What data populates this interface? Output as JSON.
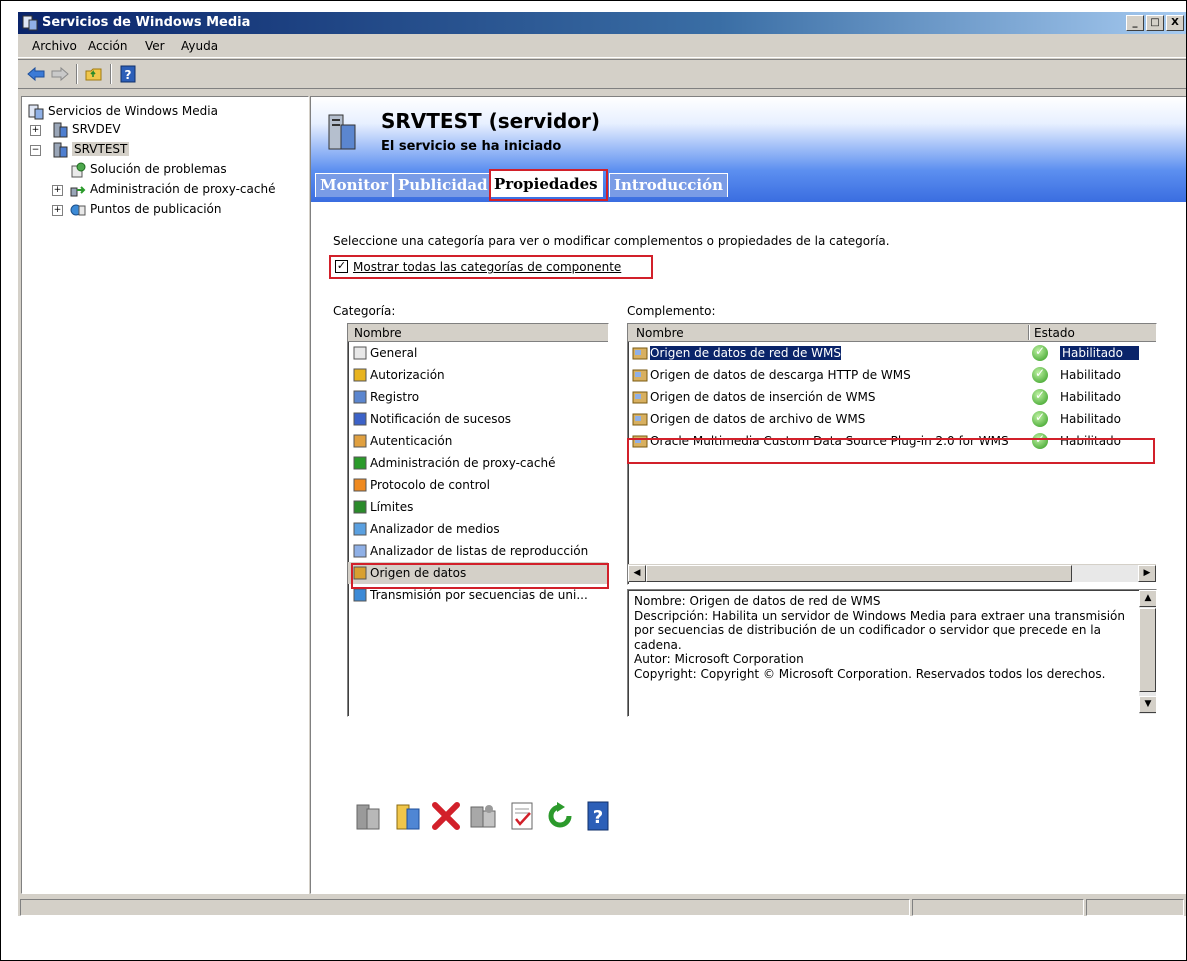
{
  "window": {
    "title": "Servicios de Windows Media",
    "buttons": [
      "_",
      "□",
      "X"
    ]
  },
  "menu": [
    "Archivo",
    "Acción",
    "Ver",
    "Ayuda"
  ],
  "toolbar": {
    "buttons": [
      {
        "name": "back-arrow-icon"
      },
      {
        "name": "forward-arrow-icon"
      },
      {
        "name": "up-folder-icon"
      },
      {
        "name": "help-icon"
      }
    ]
  },
  "tree": {
    "root": "Servicios de Windows Media",
    "items": [
      {
        "label": "SRVDEV",
        "toggle": "+",
        "level": 1
      },
      {
        "label": "SRVTEST",
        "toggle": "−",
        "level": 1
      },
      {
        "label": "Solución de problemas",
        "toggle": "",
        "level": 2
      },
      {
        "label": "Administración de proxy-caché",
        "toggle": "+",
        "level": 2
      },
      {
        "label": "Puntos de publicación",
        "toggle": "+",
        "level": 2
      }
    ]
  },
  "header": {
    "server_title": "SRVTEST (servidor)",
    "server_status": "El servicio se ha iniciado"
  },
  "tabs": [
    {
      "label": "Monitor",
      "active": false
    },
    {
      "label": "Publicidad",
      "active": false
    },
    {
      "label": "Propiedades",
      "active": true
    },
    {
      "label": "Introducción",
      "active": false
    }
  ],
  "properties": {
    "instruction": "Seleccione una categoría para ver o modificar complementos o propiedades de la categoría.",
    "show_all_checkbox": {
      "label": "Mostrar todas las categorías de componente",
      "checked": true,
      "mark": "✓"
    },
    "category_label": "Categoría:",
    "plugin_label": "Complemento:",
    "category_list": {
      "header": "Nombre",
      "items": [
        "General",
        "Autorización",
        "Registro",
        "Notificación de sucesos",
        "Autenticación",
        "Administración de proxy-caché",
        "Protocolo de control",
        "Límites",
        "Analizador de medios",
        "Analizador de listas de reproducción",
        "Origen de datos",
        "Transmisión por secuencias de uni..."
      ],
      "selected": "Origen de datos"
    },
    "plugin_list": {
      "headers": [
        "Nombre",
        "Estado"
      ],
      "rows": [
        {
          "name": "Origen de datos de red de WMS",
          "status": "Habilitado"
        },
        {
          "name": "Origen de datos de descarga HTTP de WMS",
          "status": "Habilitado"
        },
        {
          "name": "Origen de datos de inserción de WMS",
          "status": "Habilitado"
        },
        {
          "name": "Origen de datos de archivo de WMS",
          "status": "Habilitado"
        },
        {
          "name": "Oracle Multimedia Custom Data Source Plug-in 2.0 for WMS",
          "status": "Habilitado"
        }
      ],
      "selected": "Origen de datos de red de WMS"
    },
    "description": [
      "Nombre: Origen de datos de red de WMS",
      "Descripción: Habilita un servidor de Windows Media para extraer una transmisión por secuencias de distribución de un codificador o servidor que precede en la cadena.",
      "Autor: Microsoft Corporation",
      "Copyright: Copyright © Microsoft Corporation.  Reservados todos los derechos."
    ],
    "action_icons": [
      "disable-icon",
      "copy-icon",
      "delete-icon",
      "properties-icon",
      "check-icon",
      "refresh-icon",
      "help-icon"
    ]
  },
  "colors": {
    "highlight": "#d2202a",
    "tab_inactive": "#7a9ce6",
    "selection": "#0a246a"
  }
}
